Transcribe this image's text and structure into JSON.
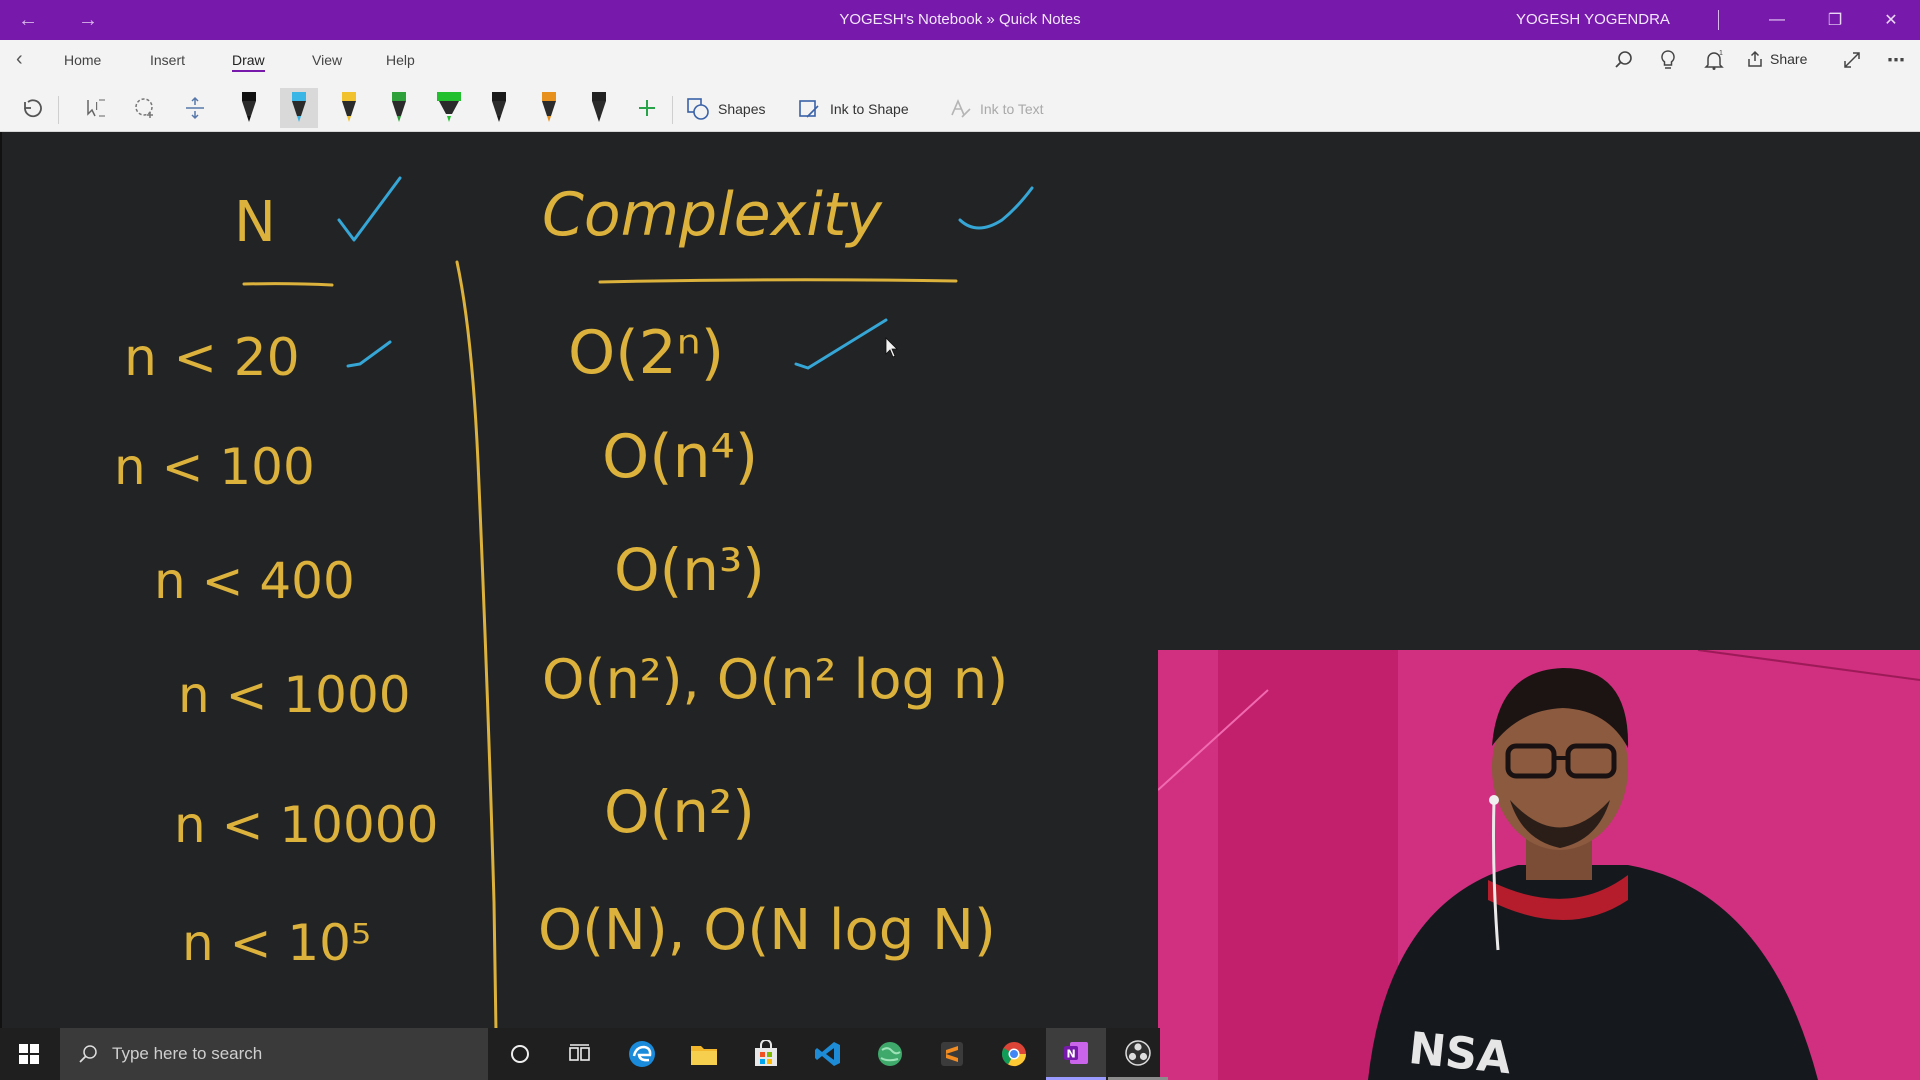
{
  "window": {
    "title": "YOGESH's Notebook » Quick Notes",
    "user": "YOGESH YOGENDRA"
  },
  "ribbon": {
    "tabs": [
      "Home",
      "Insert",
      "Draw",
      "View",
      "Help"
    ],
    "active_tab": "Draw",
    "share_label": "Share",
    "shapes_label": "Shapes",
    "ink_to_shape_label": "Ink to Shape",
    "ink_to_text_label": "Ink to Text",
    "accent_color": "#7719aa",
    "pens": [
      {
        "name": "black-pen",
        "color": "#111111"
      },
      {
        "name": "light-blue-pen",
        "color": "#39b5e6"
      },
      {
        "name": "yellow-pen",
        "color": "#f2c12e"
      },
      {
        "name": "green-pen",
        "color": "#2fa13a"
      },
      {
        "name": "green-highlighter",
        "color": "#22c02f"
      },
      {
        "name": "black-pen-2",
        "color": "#1a1a1a"
      },
      {
        "name": "orange-pen",
        "color": "#e8901c"
      },
      {
        "name": "dark-pen",
        "color": "#222222"
      }
    ]
  },
  "notes": {
    "ink_color": "#dcb23c",
    "check_color": "#35a6d6",
    "header_n": "N",
    "header_complexity": "Complexity",
    "rows": [
      {
        "n": "n < 20",
        "complexity": "O(2ⁿ)"
      },
      {
        "n": "n < 100",
        "complexity": "O(n⁴)"
      },
      {
        "n": "n < 400",
        "complexity": "O(n³)"
      },
      {
        "n": "n < 1000",
        "complexity": "O(n²), O(n² log n)"
      },
      {
        "n": "n < 10000",
        "complexity": "O(n²)"
      },
      {
        "n": "n < 10⁵",
        "complexity": "O(N), O(N log N)"
      }
    ]
  },
  "taskbar": {
    "search_placeholder": "Type here to search",
    "apps": [
      "cortana-icon",
      "task-view-icon",
      "edge-icon",
      "file-explorer-icon",
      "store-icon",
      "vscode-icon",
      "globe-icon",
      "sublime-icon",
      "chrome-icon",
      "onenote-icon",
      "obs-icon"
    ]
  }
}
